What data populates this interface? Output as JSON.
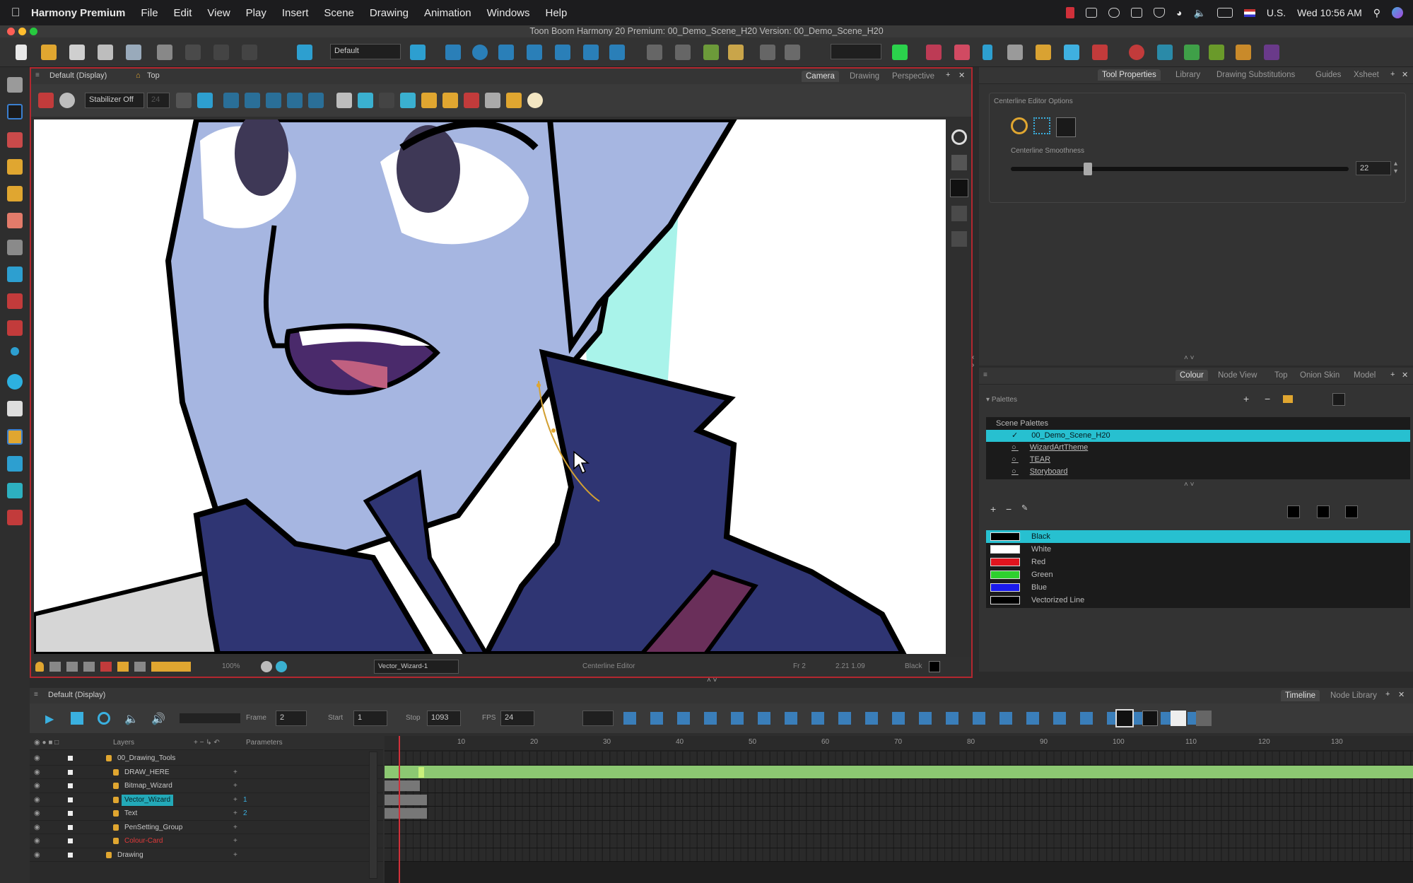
{
  "menubar": {
    "app_name": "Harmony Premium",
    "menus": [
      "File",
      "Edit",
      "View",
      "Play",
      "Insert",
      "Scene",
      "Drawing",
      "Animation",
      "Windows",
      "Help"
    ],
    "locale": "U.S.",
    "clock": "Wed 10:56 AM"
  },
  "window": {
    "title": "Toon Boom Harmony 20 Premium: 00_Demo_Scene_H20 Version: 00_Demo_Scene_H20"
  },
  "main_toolbar": {
    "workspace_combo": "Default"
  },
  "camera_view": {
    "view_label": "Default (Display)",
    "home_label": "Top",
    "tabs": [
      "Camera",
      "Drawing",
      "Perspective"
    ],
    "active_tab": "Camera",
    "stabilizer": "Stabilizer Off",
    "stabilizer_value": "24",
    "status": {
      "zoom": "100%",
      "drawing": "Vector_Wizard-1",
      "tool": "Centerline Editor",
      "frame": "Fr 2",
      "coords": "2.21 1.09",
      "colour": "Black"
    }
  },
  "tool_properties": {
    "tabs": [
      "Tool Properties",
      "Library",
      "Drawing Substitutions",
      "Guides",
      "Xsheet"
    ],
    "active_tab": "Tool Properties",
    "section_title": "Centerline Editor Options",
    "smoothness_label": "Centerline Smoothness",
    "smoothness_value": "22",
    "smoothness_fraction": 0.22
  },
  "colour_panel": {
    "tabs": [
      "Colour",
      "Node View",
      "Top",
      "Onion Skin",
      "Model"
    ],
    "active_tab": "Colour",
    "palettes_label": "Palettes",
    "scene_palettes_label": "Scene Palettes",
    "palettes": [
      {
        "name": "00_Demo_Scene_H20",
        "selected": true
      },
      {
        "name": "WizardArtTheme",
        "selected": false
      },
      {
        "name": "TEAR",
        "selected": false
      },
      {
        "name": "Storyboard",
        "selected": false
      }
    ],
    "swatches": [
      {
        "name": "Black",
        "color": "#000000",
        "selected": true
      },
      {
        "name": "White",
        "color": "#ffffff",
        "selected": false
      },
      {
        "name": "Red",
        "color": "#e0141e",
        "selected": false
      },
      {
        "name": "Green",
        "color": "#2ed12e",
        "selected": false
      },
      {
        "name": "Blue",
        "color": "#1a1aee",
        "selected": false
      },
      {
        "name": "Vectorized Line",
        "color": "#000000",
        "selected": false
      }
    ]
  },
  "timeline": {
    "view_label": "Default (Display)",
    "tabs": [
      "Timeline",
      "Node Library"
    ],
    "active_tab": "Timeline",
    "frame_label": "Frame",
    "frame_value": "2",
    "start_label": "Start",
    "start_value": "1",
    "stop_label": "Stop",
    "stop_value": "1093",
    "fps_label": "FPS",
    "fps_value": "24",
    "layers_label": "Layers",
    "parameters_label": "Parameters",
    "ruler": [
      "10",
      "20",
      "30",
      "40",
      "50",
      "60",
      "70",
      "80",
      "90",
      "100",
      "110",
      "120",
      "130"
    ],
    "layers": [
      {
        "name": "00_Drawing_Tools",
        "indent": 0,
        "param": "",
        "selected": false,
        "red": false
      },
      {
        "name": "DRAW_HERE",
        "indent": 1,
        "param": "",
        "selected": false,
        "red": false
      },
      {
        "name": "Bitmap_Wizard",
        "indent": 1,
        "param": "",
        "selected": false,
        "red": false
      },
      {
        "name": "Vector_Wizard",
        "indent": 1,
        "param": "1",
        "selected": true,
        "red": false
      },
      {
        "name": "Text",
        "indent": 1,
        "param": "2",
        "selected": false,
        "red": false
      },
      {
        "name": "PenSetting_Group",
        "indent": 1,
        "param": "",
        "selected": false,
        "red": false
      },
      {
        "name": "Colour-Card",
        "indent": 1,
        "param": "",
        "selected": false,
        "red": true
      },
      {
        "name": "Drawing",
        "indent": 0,
        "param": "",
        "selected": false,
        "red": false
      }
    ]
  },
  "colors": {
    "accent": "#27c0d0",
    "camera_border": "#b3272f",
    "playhead": "#d0303a",
    "timeline_green": "#8cc872"
  }
}
